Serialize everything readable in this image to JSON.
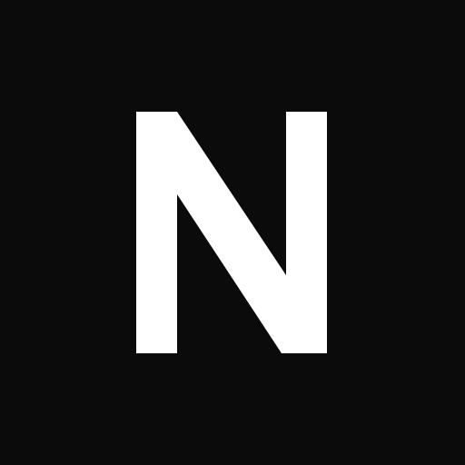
{
  "logo": {
    "letter": "N",
    "background_color": "#0b0b0b",
    "letter_color": "#ffffff"
  }
}
